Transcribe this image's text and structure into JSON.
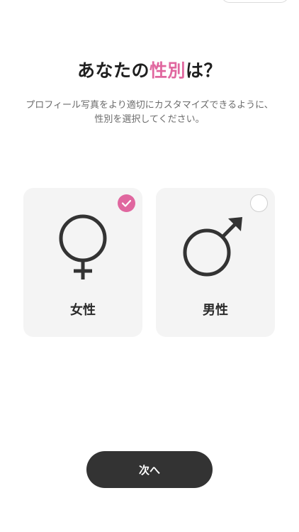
{
  "header": {
    "title_prefix": "あなたの",
    "title_accent": "性別",
    "title_suffix": "は？",
    "subtitle": "プロフィール写真をより適切にカスタマイズできるように、性別を選択してください。"
  },
  "options": [
    {
      "label": "女性",
      "icon": "female-symbol-icon",
      "selected": true
    },
    {
      "label": "男性",
      "icon": "male-symbol-icon",
      "selected": false
    }
  ],
  "next_button": {
    "label": "次へ"
  },
  "colors": {
    "accent": "#e0679f",
    "card_background": "#f4f4f4",
    "button_background": "#333333",
    "text": "#1f1f1f",
    "muted_text": "#6b6b6b"
  }
}
